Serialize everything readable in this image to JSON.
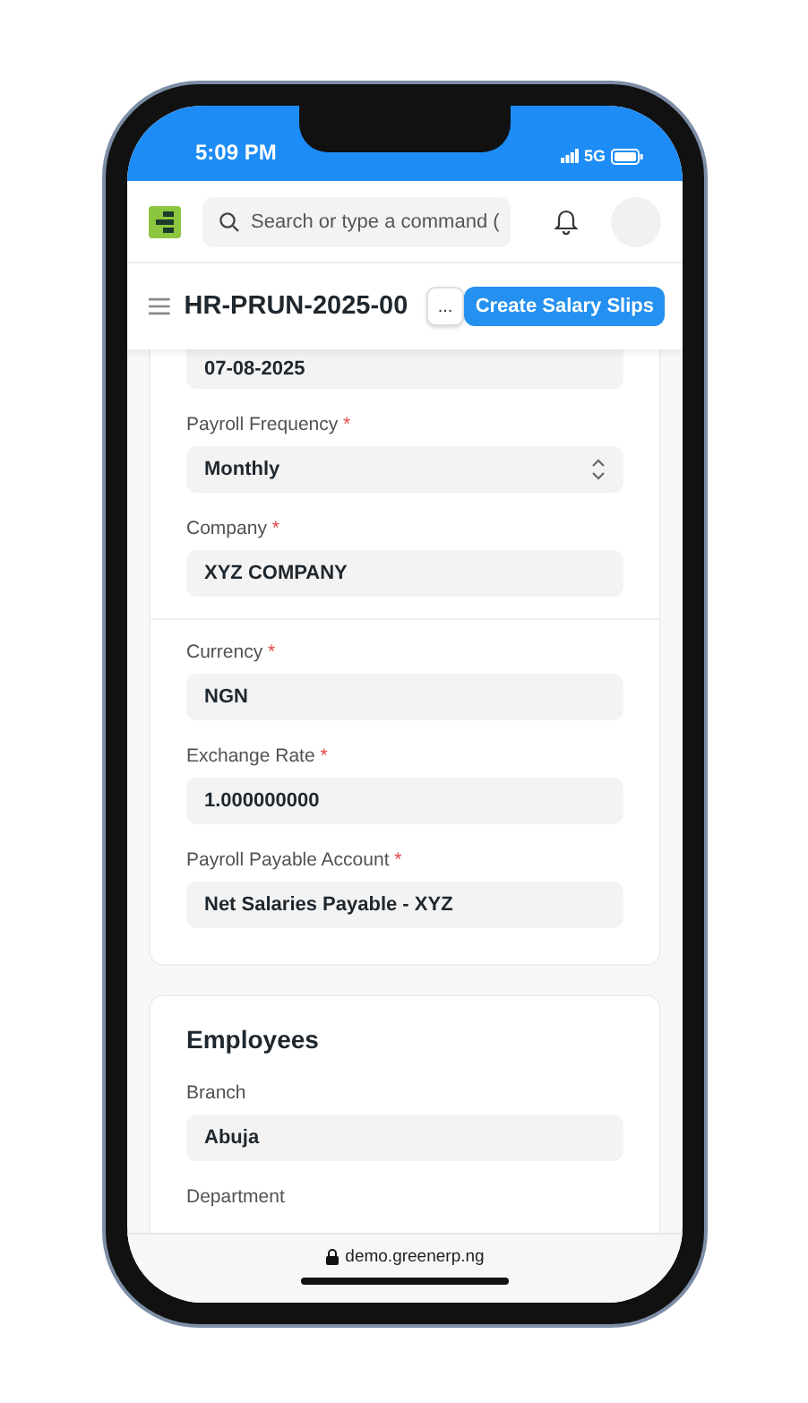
{
  "status_bar": {
    "time": "5:09 PM",
    "network": "5G"
  },
  "navbar": {
    "search": {
      "placeholder": "Search or type a command ("
    }
  },
  "title_bar": {
    "title": "HR-PRUN-2025-00",
    "more_button": "...",
    "primary_button": "Create Salary Slips"
  },
  "cards": [
    {
      "groups": [
        [
          {
            "kind": "text",
            "value": "07-08-2025"
          },
          {
            "kind": "select",
            "label": "Payroll Frequency",
            "required_mark": "*",
            "value": "Monthly"
          },
          {
            "kind": "text",
            "label": "Company",
            "required_mark": "*",
            "value": "XYZ COMPANY"
          }
        ],
        [
          {
            "kind": "text",
            "label": "Currency",
            "required_mark": "*",
            "value": "NGN"
          },
          {
            "kind": "text",
            "label": "Exchange Rate",
            "required_mark": "*",
            "value": "1.000000000"
          },
          {
            "kind": "text",
            "label": "Payroll Payable Account",
            "required_mark": "*",
            "value": "Net Salaries Payable - XYZ"
          }
        ]
      ]
    },
    {
      "title": "Employees",
      "groups": [
        [
          {
            "kind": "text",
            "label": "Branch",
            "value": "Abuja"
          },
          {
            "kind": "text",
            "label": "Department"
          }
        ]
      ]
    }
  ],
  "browser_bar": {
    "url": "demo.greenerp.ng"
  }
}
